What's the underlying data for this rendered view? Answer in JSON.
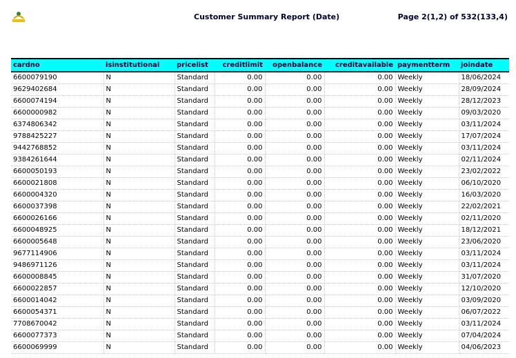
{
  "header": {
    "title": "Customer Summary Report (Date)",
    "page_info": "Page 2(1,2) of 532(133,4)"
  },
  "columns": [
    "cardno",
    "isinstitutional",
    "pricelist",
    "creditlimit",
    "openbalance",
    "creditavailable",
    "paymentterm",
    "joindate"
  ],
  "rows": [
    [
      "6600079190",
      "N",
      "Standard",
      "0.00",
      "0.00",
      "0.00",
      "Weekly",
      "18/06/2024"
    ],
    [
      "9629402684",
      "N",
      "Standard",
      "0.00",
      "0.00",
      "0.00",
      "Weekly",
      "28/09/2024"
    ],
    [
      "6600074194",
      "N",
      "Standard",
      "0.00",
      "0.00",
      "0.00",
      "Weekly",
      "28/12/2023"
    ],
    [
      "6600000982",
      "N",
      "Standard",
      "0.00",
      "0.00",
      "0.00",
      "Weekly",
      "09/03/2020"
    ],
    [
      "6374806342",
      "N",
      "Standard",
      "0.00",
      "0.00",
      "0.00",
      "Weekly",
      "03/11/2024"
    ],
    [
      "9788425227",
      "N",
      "Standard",
      "0.00",
      "0.00",
      "0.00",
      "Weekly",
      "17/07/2024"
    ],
    [
      "9442768852",
      "N",
      "Standard",
      "0.00",
      "0.00",
      "0.00",
      "Weekly",
      "03/11/2024"
    ],
    [
      "9384261644",
      "N",
      "Standard",
      "0.00",
      "0.00",
      "0.00",
      "Weekly",
      "02/11/2024"
    ],
    [
      "6600050193",
      "N",
      "Standard",
      "0.00",
      "0.00",
      "0.00",
      "Weekly",
      "23/02/2022"
    ],
    [
      "6600021808",
      "N",
      "Standard",
      "0.00",
      "0.00",
      "0.00",
      "Weekly",
      "06/10/2020"
    ],
    [
      "6600004320",
      "N",
      "Standard",
      "0.00",
      "0.00",
      "0.00",
      "Weekly",
      "16/03/2020"
    ],
    [
      "6600037398",
      "N",
      "Standard",
      "0.00",
      "0.00",
      "0.00",
      "Weekly",
      "22/02/2021"
    ],
    [
      "6600026166",
      "N",
      "Standard",
      "0.00",
      "0.00",
      "0.00",
      "Weekly",
      "02/11/2020"
    ],
    [
      "6600048925",
      "N",
      "Standard",
      "0.00",
      "0.00",
      "0.00",
      "Weekly",
      "18/12/2021"
    ],
    [
      "6600005648",
      "N",
      "Standard",
      "0.00",
      "0.00",
      "0.00",
      "Weekly",
      "23/06/2020"
    ],
    [
      "9677114906",
      "N",
      "Standard",
      "0.00",
      "0.00",
      "0.00",
      "Weekly",
      "03/11/2024"
    ],
    [
      "9486971126",
      "N",
      "Standard",
      "0.00",
      "0.00",
      "0.00",
      "Weekly",
      "03/11/2024"
    ],
    [
      "6600008845",
      "N",
      "Standard",
      "0.00",
      "0.00",
      "0.00",
      "Weekly",
      "31/07/2020"
    ],
    [
      "6600022857",
      "N",
      "Standard",
      "0.00",
      "0.00",
      "0.00",
      "Weekly",
      "12/10/2020"
    ],
    [
      "6600014042",
      "N",
      "Standard",
      "0.00",
      "0.00",
      "0.00",
      "Weekly",
      "03/09/2020"
    ],
    [
      "6600054371",
      "N",
      "Standard",
      "0.00",
      "0.00",
      "0.00",
      "Weekly",
      "06/07/2022"
    ],
    [
      "7708670042",
      "N",
      "Standard",
      "0.00",
      "0.00",
      "0.00",
      "Weekly",
      "03/11/2024"
    ],
    [
      "6600077373",
      "N",
      "Standard",
      "0.00",
      "0.00",
      "0.00",
      "Weekly",
      "07/04/2024"
    ],
    [
      "6600069999",
      "N",
      "Standard",
      "0.00",
      "0.00",
      "0.00",
      "Weekly",
      "04/06/2023"
    ]
  ],
  "colors": {
    "header_bg": "#00ffff",
    "title_text": "#000033"
  }
}
